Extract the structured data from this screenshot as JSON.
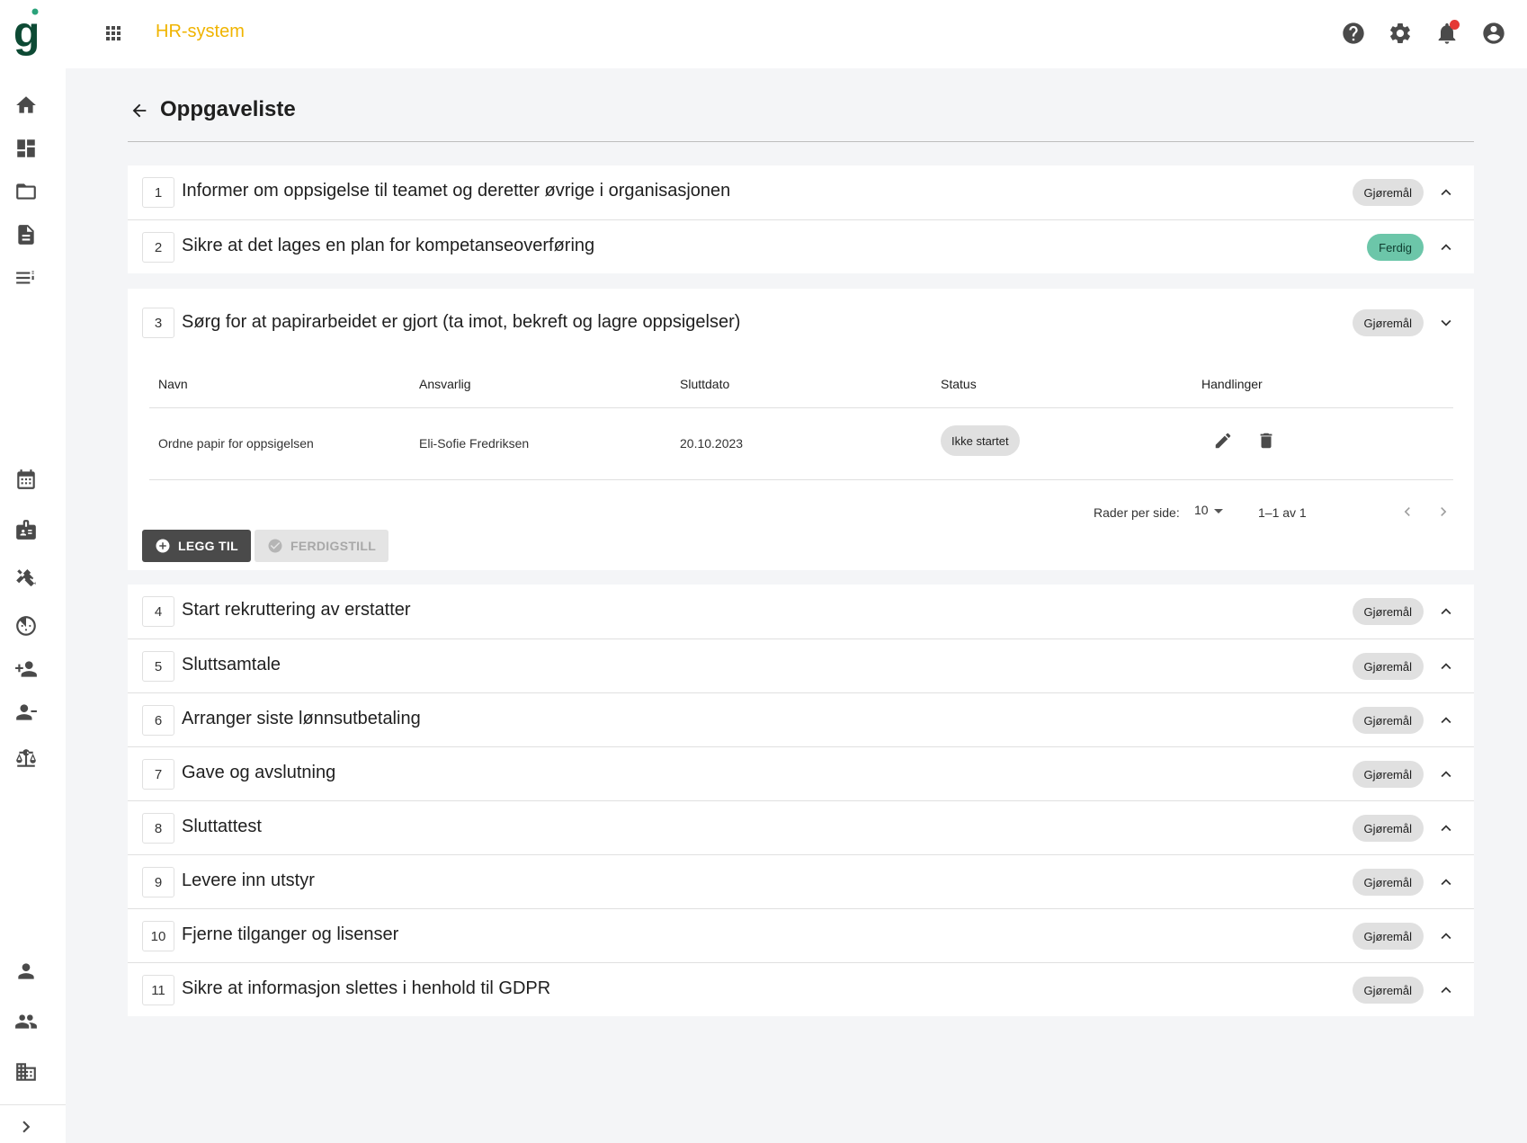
{
  "app": {
    "title": "HR-system"
  },
  "page": {
    "title": "Oppgaveliste"
  },
  "tasks": [
    {
      "num": "1",
      "title": "Informer om oppsigelse til teamet og deretter øvrige i organisasjonen",
      "status": "Gjøremål"
    },
    {
      "num": "2",
      "title": "Sikre at det lages en plan for kompetanseoverføring",
      "status": "Ferdig"
    },
    {
      "num": "3",
      "title": "Sørg for at papirarbeidet er gjort (ta imot, bekreft og lagre oppsigelser)",
      "status": "Gjøremål"
    },
    {
      "num": "4",
      "title": "Start rekruttering av erstatter",
      "status": "Gjøremål"
    },
    {
      "num": "5",
      "title": "Sluttsamtale",
      "status": "Gjøremål"
    },
    {
      "num": "6",
      "title": "Arranger siste lønnsutbetaling",
      "status": "Gjøremål"
    },
    {
      "num": "7",
      "title": "Gave og avslutning",
      "status": "Gjøremål"
    },
    {
      "num": "8",
      "title": "Sluttattest",
      "status": "Gjøremål"
    },
    {
      "num": "9",
      "title": "Levere inn utstyr",
      "status": "Gjøremål"
    },
    {
      "num": "10",
      "title": "Fjerne tilganger og lisenser",
      "status": "Gjøremål"
    },
    {
      "num": "11",
      "title": "Sikre at informasjon slettes i henhold til GDPR",
      "status": "Gjøremål"
    }
  ],
  "subtable": {
    "headers": {
      "name": "Navn",
      "owner": "Ansvarlig",
      "due": "Sluttdato",
      "status": "Status",
      "actions": "Handlinger"
    },
    "rows": [
      {
        "name": "Ordne papir for oppsigelsen",
        "owner": "Eli-Sofie Fredriksen",
        "due": "20.10.2023",
        "status": "Ikke startet"
      }
    ],
    "pagination": {
      "rows_label": "Rader per side:",
      "rows_value": "10",
      "range": "1–1 av 1"
    }
  },
  "buttons": {
    "add": "LEGG TIL",
    "complete": "FERDIGSTILL"
  },
  "colors": {
    "accent": "#f0b400",
    "done": "#6cc6a9",
    "primary_button": "#4a4a4a",
    "notification": "#e53935"
  }
}
